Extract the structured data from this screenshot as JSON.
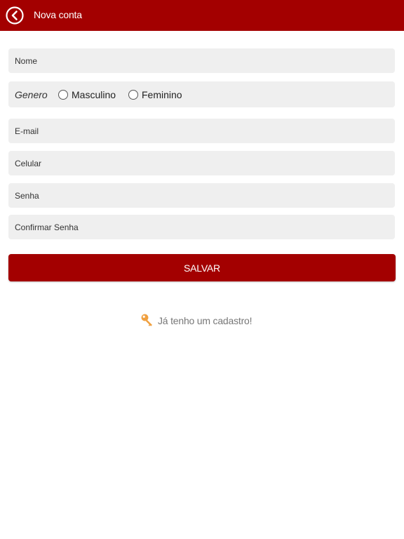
{
  "header": {
    "title": "Nova conta",
    "back_icon": "chevron-left-circle-icon",
    "background": "#a30000"
  },
  "form": {
    "name_placeholder": "Nome",
    "gender": {
      "label": "Genero",
      "options": [
        "Masculino",
        "Feminino"
      ]
    },
    "email_placeholder": "E-mail",
    "phone_placeholder": "Celular",
    "password_placeholder": "Senha",
    "confirm_password_placeholder": "Confirmar Senha",
    "save_label": "SALVAR"
  },
  "login_link": {
    "icon": "key-icon",
    "label": "Já tenho um cadastro!",
    "icon_color": "#f0a040"
  }
}
